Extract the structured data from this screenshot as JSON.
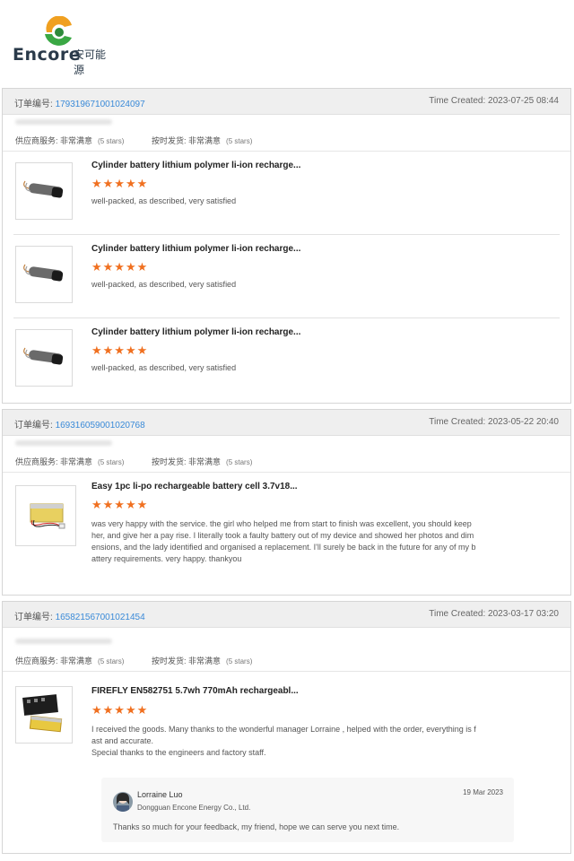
{
  "brand": {
    "name": "Encore",
    "name_cn": "安可能源"
  },
  "labels": {
    "order_no": "订单编号:",
    "time_created": "Time Created:",
    "service": "供应商服务:",
    "shipping": "按时发货:",
    "rating_word": "非常满意",
    "rating_stars": "(5 stars)"
  },
  "orders": [
    {
      "number": "179319671001024097",
      "time": "2023-07-25 08:44",
      "items": [
        {
          "name": "Cylinder battery lithium polymer li-ion recharge...",
          "stars": "★★★★★",
          "comment": "well-packed, as described, very satisfied"
        },
        {
          "name": "Cylinder battery lithium polymer li-ion recharge...",
          "stars": "★★★★★",
          "comment": "well-packed, as described, very satisfied"
        },
        {
          "name": "Cylinder battery lithium polymer li-ion recharge...",
          "stars": "★★★★★",
          "comment": "well-packed, as described, very satisfied"
        }
      ]
    },
    {
      "number": "169316059001020768",
      "time": "2023-05-22 20:40",
      "items": [
        {
          "name": "Easy 1pc li-po rechargeable battery cell 3.7v18...",
          "stars": "★★★★★",
          "comment_lines": [
            "was very happy with the service. the girl who helped me from start to finish was excellent, you should keep",
            "her, and give her a pay rise. I literally took a faulty battery out of my device and showed her photos and dim",
            "ensions, and the lady identified and organised a replacement. I'll surely be back in the future for any of my b",
            "attery requirements. very happy. thankyou"
          ]
        }
      ]
    },
    {
      "number": "165821567001021454",
      "time": "2023-03-17 03:20",
      "items": [
        {
          "name": "FIREFLY EN582751 5.7wh 770mAh rechargeabl...",
          "stars": "★★★★★",
          "comment_lines": [
            "I received the goods. Many thanks to the wonderful manager Lorraine , helped with the order, everything is f",
            "ast and accurate.",
            "Special thanks to the engineers and factory staff."
          ]
        }
      ],
      "reply": {
        "name": "Lorraine Luo",
        "company": "Dongguan Encone Energy Co., Ltd.",
        "date": "19 Mar 2023",
        "text": "Thanks so much for your feedback, my friend, hope we can serve you next time."
      }
    }
  ]
}
